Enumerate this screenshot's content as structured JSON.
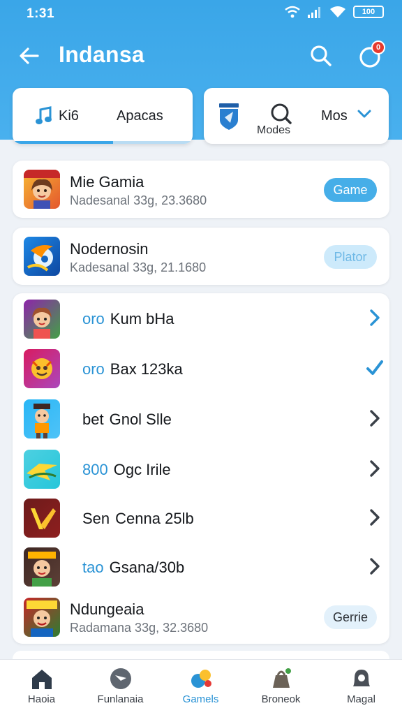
{
  "status_bar": {
    "time": "1:31",
    "battery": "100"
  },
  "appbar": {
    "title": "Indansa",
    "notification_count": "0"
  },
  "tabs": [
    {
      "label": "Ki6"
    },
    {
      "label": "Apacas"
    }
  ],
  "filter": {
    "label": "Modes",
    "dropdown_label": "Mos"
  },
  "featured": [
    {
      "title": "Mie Gamia",
      "subtitle": "Nadesanal 33g, 23.3680",
      "button": "Game"
    },
    {
      "title": "Nodernosin",
      "subtitle": "Kadesanal 33g, 21.1680",
      "button": "Plator"
    }
  ],
  "list": [
    {
      "prefix": "oro",
      "name": "Kum bHa",
      "action": "chevron"
    },
    {
      "prefix": "oro",
      "name": "Bax 123ka",
      "action": "check"
    },
    {
      "prefix": "bet",
      "name": "Gnol Slle",
      "action": "chevron"
    },
    {
      "prefix": "800",
      "name": "Ogc Irile",
      "action": "chevron"
    },
    {
      "prefix": "Sen",
      "name": "Cenna 25lb",
      "action": "chevron"
    },
    {
      "prefix": "tao",
      "name": "Gsana/30b",
      "action": "chevron"
    }
  ],
  "last_item": {
    "title": "Ndungeaia",
    "subtitle": "Radamana 33g, 32.3680",
    "button": "Gerrie"
  },
  "bottom_nav": [
    {
      "label": "Haoia",
      "icon": "home-icon"
    },
    {
      "label": "Funlanaia",
      "icon": "compass-icon"
    },
    {
      "label": "Gamels",
      "icon": "games-icon"
    },
    {
      "label": "Broneok",
      "icon": "bag-icon"
    },
    {
      "label": "Magal",
      "icon": "bell-icon"
    }
  ],
  "colors": {
    "accent": "#3aa6e8",
    "header": "#45adec",
    "nav_active": "#2a93d5"
  }
}
